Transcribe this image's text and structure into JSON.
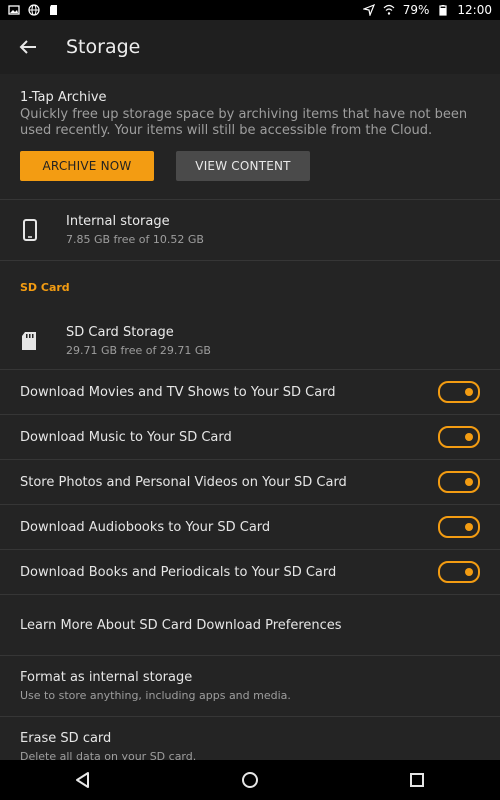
{
  "status_bar": {
    "battery": "79%",
    "time": "12:00"
  },
  "app_bar": {
    "title": "Storage"
  },
  "archive": {
    "title": "1-Tap Archive",
    "description": "Quickly free up storage space by archiving items that have not been used recently. Your items will still be accessible from the Cloud.",
    "archive_button": "ARCHIVE NOW",
    "view_button": "VIEW CONTENT"
  },
  "internal_storage": {
    "title": "Internal storage",
    "subtitle": "7.85 GB free of 10.52 GB"
  },
  "sd_section": {
    "header": "SD Card"
  },
  "sd_storage": {
    "title": "SD Card Storage",
    "subtitle": "29.71 GB free of 29.71 GB"
  },
  "toggles": [
    {
      "label": "Download Movies and TV Shows to Your SD Card",
      "enabled": true
    },
    {
      "label": "Download Music to Your SD Card",
      "enabled": true
    },
    {
      "label": "Store Photos and Personal Videos on Your SD Card",
      "enabled": true
    },
    {
      "label": "Download Audiobooks to Your SD Card",
      "enabled": true
    },
    {
      "label": "Download Books and Periodicals to Your SD Card",
      "enabled": true
    }
  ],
  "learn_more": "Learn More About SD Card Download Preferences",
  "format": {
    "title": "Format as internal storage",
    "subtitle": "Use to store anything, including apps and media."
  },
  "erase": {
    "title": "Erase SD card",
    "subtitle": "Delete all data on your SD card."
  },
  "colors": {
    "accent": "#f39c12",
    "background": "#242424"
  }
}
